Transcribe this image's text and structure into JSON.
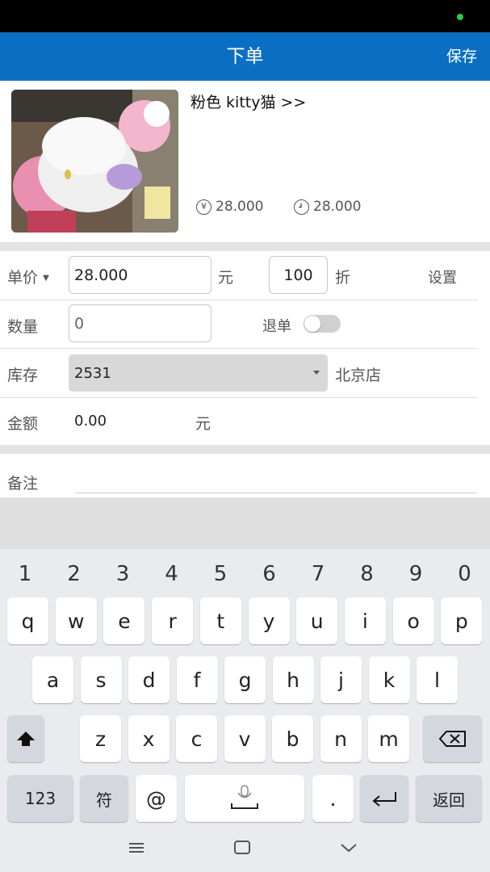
{
  "header": {
    "title": "下单",
    "save_label": "保存"
  },
  "product": {
    "name": "粉色 kitty猫 >>",
    "price_label": "28.000",
    "cost_label": "28.000",
    "price_icon": "yen-icon",
    "cost_icon": "clock-icon"
  },
  "form": {
    "unit_price_label": "单价",
    "unit_price_value": "28.000",
    "unit_price_unit": "元",
    "discount_value": "100",
    "discount_unit": "折",
    "settings_label": "设置",
    "quantity_label": "数量",
    "quantity_placeholder": "0",
    "return_label": "退单",
    "return_on": false,
    "stock_label": "库存",
    "stock_value": "2531",
    "store_name": "北京店",
    "amount_label": "金额",
    "amount_value": "0.00",
    "amount_unit": "元",
    "remark_label": "备注"
  },
  "keyboard": {
    "numbers": [
      "1",
      "2",
      "3",
      "4",
      "5",
      "6",
      "7",
      "8",
      "9",
      "0"
    ],
    "row1": [
      "q",
      "w",
      "e",
      "r",
      "t",
      "y",
      "u",
      "i",
      "o",
      "p"
    ],
    "row2": [
      "a",
      "s",
      "d",
      "f",
      "g",
      "h",
      "j",
      "k",
      "l"
    ],
    "row3": [
      "z",
      "x",
      "c",
      "v",
      "b",
      "n",
      "m"
    ],
    "key_123": "123",
    "key_symbol": "符",
    "key_at": "@",
    "key_period": ".",
    "key_back": "返回"
  },
  "colors": {
    "header": "#0a6fc2",
    "status_dot": "#2ecc40"
  }
}
